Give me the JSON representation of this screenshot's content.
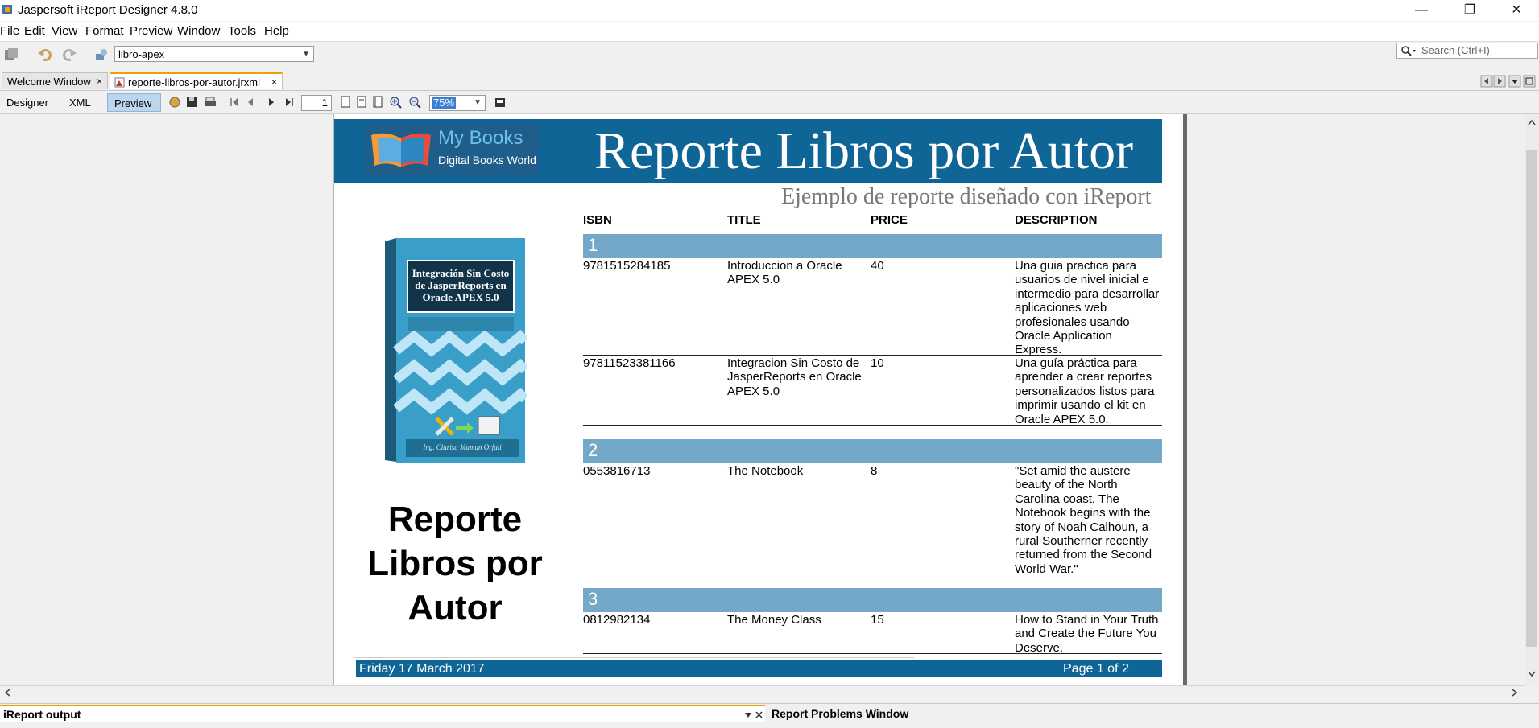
{
  "window": {
    "title": "Jaspersoft iReport Designer 4.8.0",
    "controls": [
      "—",
      "❐",
      "✕"
    ]
  },
  "menu": [
    "File",
    "Edit",
    "View",
    "Format",
    "Preview",
    "Window",
    "Tools",
    "Help"
  ],
  "toolbar": {
    "datasource": "libro-apex",
    "search_placeholder": "Search (Ctrl+I)"
  },
  "tabs": [
    {
      "label": "Welcome Window",
      "close": "×"
    },
    {
      "label": "reporte-libros-por-autor.jrxml",
      "close": "×"
    }
  ],
  "preview_toolbar": {
    "modes": [
      "Designer",
      "XML",
      "Preview"
    ],
    "active_mode": "Preview",
    "page": "1",
    "zoom": "75%"
  },
  "report": {
    "logo_title": "My Books",
    "logo_subtitle": "Digital Books World",
    "title": "Reporte Libros por Autor",
    "subtitle": "Ejemplo de reporte diseñado con iReport",
    "columns": [
      "ISBN",
      "TITLE",
      "PRICE",
      "DESCRIPTION"
    ],
    "book_cover": {
      "title": "Integración Sin Costo de JasperReports en Oracle APEX 5.0",
      "author": "Ing. Clarisa Maman Orfali"
    },
    "side_title": "Reporte Libros por Autor",
    "groups": [
      {
        "label": "1",
        "rows": [
          {
            "isbn": "9781515284185",
            "title": "Introduccion a Oracle APEX 5.0",
            "price": "40",
            "description": "Una guia practica para usuarios de nivel inicial e intermedio para desarrollar aplicaciones web profesionales usando Oracle Application Express."
          },
          {
            "isbn": "97811523381166",
            "title": "Integracion Sin Costo de JasperReports en Oracle APEX 5.0",
            "price": "10",
            "description": "Una guía práctica para aprender a crear reportes personalizados listos para imprimir usando el kit en Oracle APEX 5.0."
          }
        ]
      },
      {
        "label": "2",
        "rows": [
          {
            "isbn": "0553816713",
            "title": "The Notebook",
            "price": "8",
            "description": "\"Set amid the austere beauty of the North Carolina coast, The Notebook begins with the story of Noah Calhoun, a rural Southerner recently returned from the Second World War.\""
          }
        ]
      },
      {
        "label": "3",
        "rows": [
          {
            "isbn": "0812982134",
            "title": "The Money Class",
            "price": "15",
            "description": "How to Stand in Your Truth and Create the Future You Deserve."
          }
        ]
      }
    ],
    "footer_date": "Friday 17 March 2017",
    "footer_page": "Page 1 of 2"
  },
  "bottom_panels": {
    "output": "iReport output",
    "problems": "Report Problems Window"
  }
}
